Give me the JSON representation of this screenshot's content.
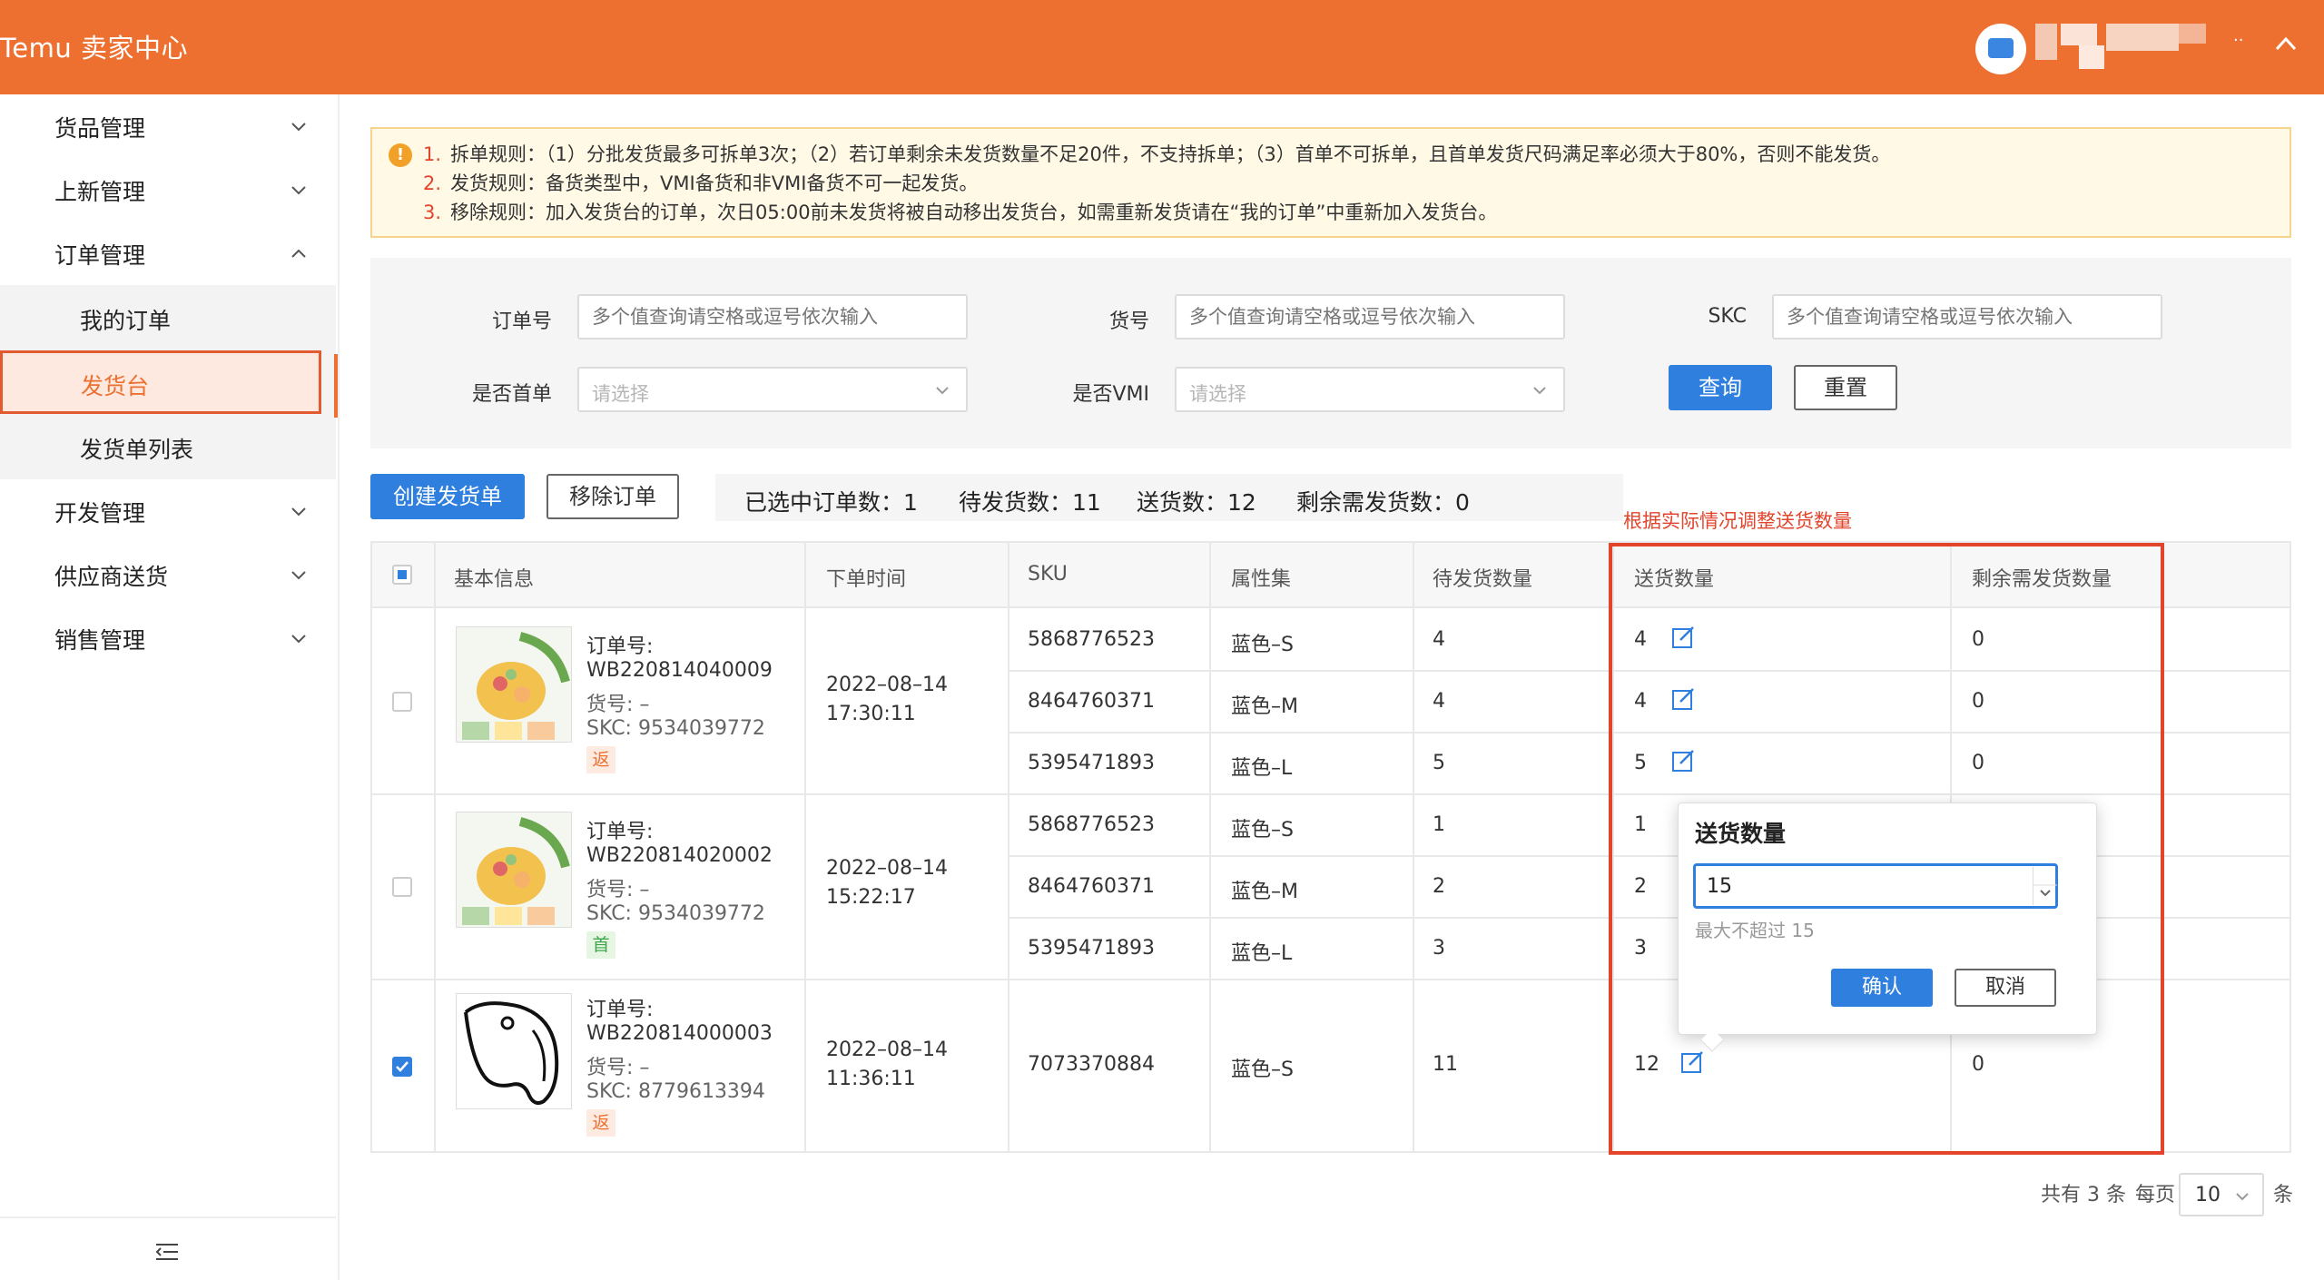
{
  "header": {
    "brand": "Temu 卖家中心",
    "dots": "··"
  },
  "sidebar": {
    "items": [
      {
        "label": "货品管理",
        "expanded": false
      },
      {
        "label": "上新管理",
        "expanded": false
      },
      {
        "label": "订单管理",
        "expanded": true
      },
      {
        "label": "开发管理",
        "expanded": false
      },
      {
        "label": "供应商送货",
        "expanded": false
      },
      {
        "label": "销售管理",
        "expanded": false
      }
    ],
    "sub_items": [
      {
        "label": "我的订单"
      },
      {
        "label": "发货台",
        "active": true
      },
      {
        "label": "发货单列表"
      }
    ]
  },
  "notice": {
    "lines": [
      {
        "num": "1.",
        "text": "拆单规则：（1）分批发货最多可拆单3次；（2）若订单剩余未发货数量不足20件，不支持拆单；（3）首单不可拆单，且首单发货尺码满足率必须大于80%，否则不能发货。"
      },
      {
        "num": "2.",
        "text": "发货规则：备货类型中，VMI备货和非VMI备货不可一起发货。"
      },
      {
        "num": "3.",
        "text": "移除规则：加入发货台的订单，次日05:00前未发货将被自动移出发货台，如需重新发货请在“我的订单”中重新加入发货台。"
      }
    ]
  },
  "filters": {
    "order_no": {
      "label": "订单号",
      "placeholder": "多个值查询请空格或逗号依次输入"
    },
    "item_no": {
      "label": "货号",
      "placeholder": "多个值查询请空格或逗号依次输入"
    },
    "skc": {
      "label": "SKC",
      "placeholder": "多个值查询请空格或逗号依次输入"
    },
    "first_order": {
      "label": "是否首单",
      "placeholder": "请选择"
    },
    "vmi": {
      "label": "是否VMI",
      "placeholder": "请选择"
    },
    "query_label": "查询",
    "reset_label": "重置"
  },
  "actions": {
    "create_label": "创建发货单",
    "remove_label": "移除订单",
    "selected": "已选中订单数：1",
    "pending": "待发货数：11",
    "ship": "送货数：12",
    "remaining": "剩余需发货数：0"
  },
  "annotation": "根据实际情况调整送货数量",
  "table": {
    "headers": [
      "基本信息",
      "下单时间",
      "SKU",
      "属性集",
      "待发货数量",
      "送货数量",
      "剩余需发货数量"
    ],
    "orders": [
      {
        "order_label": "订单号:",
        "order_no": "WB220814040009",
        "item_no": "货号: –",
        "skc": "SKC: 9534039772",
        "tag": "返",
        "date": "2022–08–14",
        "time": "17:30:11",
        "checked": false,
        "rows": [
          {
            "sku": "5868776523",
            "attr": "蓝色–S",
            "pending": "4",
            "ship": "4",
            "remaining": "0"
          },
          {
            "sku": "8464760371",
            "attr": "蓝色–M",
            "pending": "4",
            "ship": "4",
            "remaining": "0"
          },
          {
            "sku": "5395471893",
            "attr": "蓝色–L",
            "pending": "5",
            "ship": "5",
            "remaining": "0"
          }
        ]
      },
      {
        "order_label": "订单号:",
        "order_no": "WB220814020002",
        "item_no": "货号: –",
        "skc": "SKC: 9534039772",
        "tag": "首",
        "date": "2022–08–14",
        "time": "15:22:17",
        "checked": false,
        "rows": [
          {
            "sku": "5868776523",
            "attr": "蓝色–S",
            "pending": "1",
            "ship": "1",
            "remaining": ""
          },
          {
            "sku": "8464760371",
            "attr": "蓝色–M",
            "pending": "2",
            "ship": "2",
            "remaining": ""
          },
          {
            "sku": "5395471893",
            "attr": "蓝色–L",
            "pending": "3",
            "ship": "3",
            "remaining": ""
          }
        ]
      },
      {
        "order_label": "订单号:",
        "order_no": "WB220814000003",
        "item_no": "货号: –",
        "skc": "SKC: 8779613394",
        "tag": "返",
        "date": "2022–08–14",
        "time": "11:36:11",
        "checked": true,
        "rows": [
          {
            "sku": "7073370884",
            "attr": "蓝色–S",
            "pending": "11",
            "ship": "12",
            "remaining": "0"
          }
        ]
      }
    ]
  },
  "popover": {
    "title": "送货数量",
    "value": "15",
    "hint": "最大不超过 15",
    "confirm_label": "确认",
    "cancel_label": "取消"
  },
  "pagination": {
    "total": "共有 3 条",
    "per_page_label": "每页",
    "page_size": "10",
    "unit": "条"
  },
  "colors": {
    "brand": "#ed7031",
    "primary": "#2f7fdf",
    "highlight": "#e2442c"
  }
}
